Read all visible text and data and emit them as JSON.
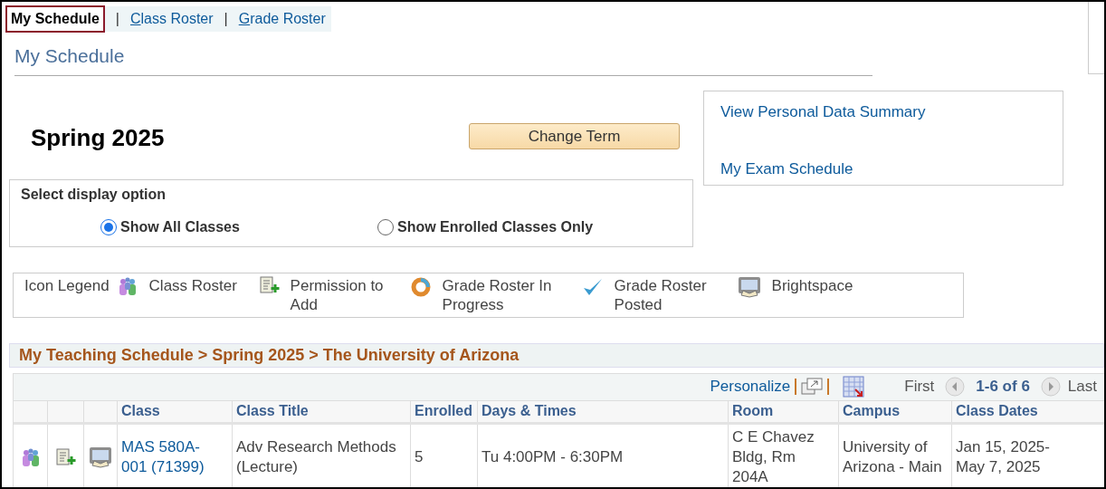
{
  "nav_tabs": [
    {
      "label": "My Schedule",
      "selected": true,
      "underline_first": false
    },
    {
      "separator": "|",
      "label": "Class Roster",
      "selected": false,
      "underline_first": true
    },
    {
      "separator": "|",
      "label": "Grade Roster",
      "selected": false,
      "underline_first": true
    }
  ],
  "page_title": "My Schedule",
  "term": "Spring 2025",
  "change_term_button": "Change Term",
  "links": [
    "View Personal Data Summary",
    "My Exam Schedule"
  ],
  "display_option": {
    "title": "Select display option",
    "options": [
      {
        "label": "Show All Classes",
        "selected": true
      },
      {
        "label": "Show Enrolled Classes Only",
        "selected": false
      }
    ]
  },
  "legend": {
    "label": "Icon Legend",
    "items": [
      {
        "kind": "roster",
        "label": "Class Roster"
      },
      {
        "kind": "permission",
        "label": "Permission to Add"
      },
      {
        "kind": "progress",
        "label": "Grade Roster In Progress"
      },
      {
        "kind": "posted",
        "label": "Grade Roster Posted"
      },
      {
        "kind": "brightspace",
        "label": "Brightspace"
      }
    ]
  },
  "schedule_heading": "My Teaching Schedule > Spring 2025 > The University of Arizona",
  "grid_toolbar": {
    "personalize": "Personalize",
    "first": "First",
    "range": "1-6 of 6",
    "last": "Last"
  },
  "table": {
    "columns": [
      "Class",
      "Class Title",
      "Enrolled",
      "Days & Times",
      "Room",
      "Campus",
      "Class Dates"
    ],
    "rows": [
      {
        "cells": [
          "MAS 580A-001 (71399)",
          "Adv Research Methods (Lecture)",
          "5",
          "Tu 4:00PM - 6:30PM",
          "C E Chavez Bldg, Rm 204A",
          "University of Arizona - Main",
          "Jan 15, 2025-May 7, 2025"
        ]
      }
    ]
  }
}
